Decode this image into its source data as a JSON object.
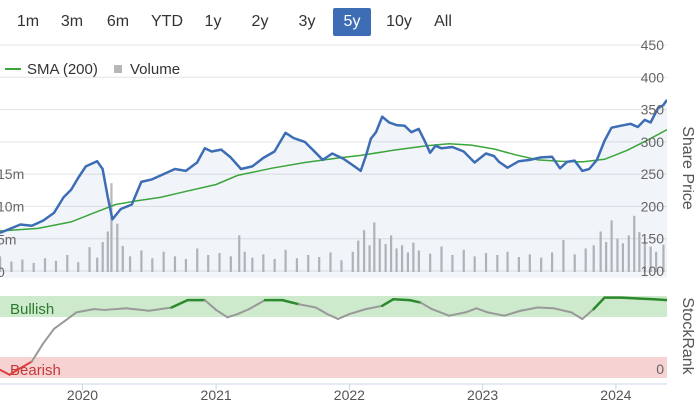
{
  "range_buttons": [
    {
      "label": "1m",
      "active": false
    },
    {
      "label": "3m",
      "active": false
    },
    {
      "label": "6m",
      "active": false
    },
    {
      "label": "YTD",
      "active": false
    },
    {
      "label": "1y",
      "active": false
    },
    {
      "label": "2y",
      "active": false
    },
    {
      "label": "3y",
      "active": false
    },
    {
      "label": "5y",
      "active": true
    },
    {
      "label": "10y",
      "active": false
    },
    {
      "label": "All",
      "active": false
    }
  ],
  "chart_data": {
    "type": "line",
    "colors": {
      "price": "#3d6db5",
      "sma": "#3aa53a",
      "volume": "#b8b8b8",
      "bullish_band": "#cdeacd",
      "bearish_band": "#f6d2d2",
      "rank_bullish": "#2c8a2c",
      "rank_neutral": "#999999",
      "rank_bearish": "#d94040",
      "active_button": "#3d6db5"
    },
    "legend": [
      {
        "label": "SMA (200)",
        "kind": "line"
      },
      {
        "label": "Volume",
        "kind": "square"
      }
    ],
    "x_axis": {
      "range": [
        "2019-05-20",
        "2024-05-20"
      ],
      "ticks": [
        {
          "label": "2020",
          "date": "2020-01-01"
        },
        {
          "label": "2021",
          "date": "2021-01-01"
        },
        {
          "label": "2022",
          "date": "2022-01-01"
        },
        {
          "label": "2023",
          "date": "2023-01-01"
        },
        {
          "label": "2024",
          "date": "2024-01-01"
        }
      ]
    },
    "price_axis": {
      "label": "Share Price",
      "range": [
        100,
        450
      ],
      "ticks": [
        "100",
        "150",
        "200",
        "250",
        "300",
        "350",
        "400",
        "450"
      ],
      "tick_values": [
        100,
        150,
        200,
        250,
        300,
        350,
        400,
        450
      ]
    },
    "volume_axis": {
      "ticks": [
        "0",
        "5m",
        "10m",
        "15m"
      ],
      "tick_values": [
        0,
        5,
        10,
        15
      ],
      "unit": "m"
    },
    "rank_panel": {
      "label": "StockRank",
      "zones": {
        "bullish": "Bullish",
        "bearish": "Bearish"
      },
      "range": [
        0,
        100
      ],
      "tick": "0",
      "tick_value": 0
    },
    "price_series": [
      [
        "2019-05-20",
        159
      ],
      [
        "2019-06-15",
        165
      ],
      [
        "2019-07-15",
        172
      ],
      [
        "2019-08-15",
        170
      ],
      [
        "2019-09-15",
        178
      ],
      [
        "2019-10-15",
        190
      ],
      [
        "2019-11-10",
        214
      ],
      [
        "2019-12-01",
        226
      ],
      [
        "2019-12-20",
        244
      ],
      [
        "2020-01-10",
        262
      ],
      [
        "2020-02-10",
        270
      ],
      [
        "2020-02-25",
        258
      ],
      [
        "2020-03-10",
        215
      ],
      [
        "2020-03-23",
        180
      ],
      [
        "2020-04-15",
        196
      ],
      [
        "2020-05-15",
        203
      ],
      [
        "2020-06-10",
        238
      ],
      [
        "2020-07-10",
        242
      ],
      [
        "2020-08-10",
        250
      ],
      [
        "2020-09-10",
        258
      ],
      [
        "2020-10-10",
        255
      ],
      [
        "2020-11-10",
        268
      ],
      [
        "2020-12-01",
        290
      ],
      [
        "2020-12-20",
        285
      ],
      [
        "2021-01-15",
        288
      ],
      [
        "2021-02-10",
        276
      ],
      [
        "2021-03-10",
        258
      ],
      [
        "2021-04-10",
        262
      ],
      [
        "2021-05-10",
        275
      ],
      [
        "2021-06-10",
        285
      ],
      [
        "2021-07-10",
        314
      ],
      [
        "2021-08-01",
        306
      ],
      [
        "2021-09-01",
        300
      ],
      [
        "2021-10-01",
        283
      ],
      [
        "2021-10-20",
        272
      ],
      [
        "2021-11-15",
        282
      ],
      [
        "2021-12-15",
        274
      ],
      [
        "2022-01-15",
        262
      ],
      [
        "2022-02-01",
        255
      ],
      [
        "2022-02-15",
        278
      ],
      [
        "2022-03-01",
        305
      ],
      [
        "2022-03-15",
        315
      ],
      [
        "2022-04-01",
        339
      ],
      [
        "2022-04-20",
        330
      ],
      [
        "2022-05-10",
        326
      ],
      [
        "2022-06-01",
        325
      ],
      [
        "2022-06-20",
        315
      ],
      [
        "2022-07-10",
        320
      ],
      [
        "2022-07-25",
        303
      ],
      [
        "2022-08-10",
        283
      ],
      [
        "2022-08-25",
        294
      ],
      [
        "2022-09-10",
        290
      ],
      [
        "2022-10-10",
        292
      ],
      [
        "2022-11-10",
        285
      ],
      [
        "2022-12-10",
        268
      ],
      [
        "2023-01-10",
        282
      ],
      [
        "2023-02-01",
        278
      ],
      [
        "2023-02-15",
        269
      ],
      [
        "2023-03-10",
        260
      ],
      [
        "2023-04-10",
        270
      ],
      [
        "2023-05-10",
        272
      ],
      [
        "2023-06-10",
        276
      ],
      [
        "2023-07-10",
        277
      ],
      [
        "2023-08-01",
        259
      ],
      [
        "2023-08-20",
        269
      ],
      [
        "2023-09-10",
        271
      ],
      [
        "2023-10-01",
        255
      ],
      [
        "2023-10-20",
        258
      ],
      [
        "2023-11-10",
        272
      ],
      [
        "2023-12-01",
        302
      ],
      [
        "2023-12-20",
        322
      ],
      [
        "2024-01-15",
        325
      ],
      [
        "2024-02-10",
        328
      ],
      [
        "2024-03-01",
        323
      ],
      [
        "2024-03-20",
        334
      ],
      [
        "2024-04-05",
        330
      ],
      [
        "2024-04-25",
        352
      ],
      [
        "2024-05-10",
        357
      ],
      [
        "2024-05-20",
        365
      ]
    ],
    "sma_series": [
      [
        "2019-05-20",
        162
      ],
      [
        "2019-09-01",
        166
      ],
      [
        "2019-12-01",
        176
      ],
      [
        "2020-02-01",
        190
      ],
      [
        "2020-04-01",
        203
      ],
      [
        "2020-06-01",
        209
      ],
      [
        "2020-08-01",
        214
      ],
      [
        "2020-10-01",
        222
      ],
      [
        "2021-01-01",
        234
      ],
      [
        "2021-03-01",
        248
      ],
      [
        "2021-06-01",
        259
      ],
      [
        "2021-09-01",
        268
      ],
      [
        "2021-12-01",
        275
      ],
      [
        "2022-02-01",
        279
      ],
      [
        "2022-05-01",
        287
      ],
      [
        "2022-08-01",
        294
      ],
      [
        "2022-10-01",
        297
      ],
      [
        "2022-12-01",
        295
      ],
      [
        "2023-02-01",
        289
      ],
      [
        "2023-04-01",
        280
      ],
      [
        "2023-06-01",
        272
      ],
      [
        "2023-08-01",
        270
      ],
      [
        "2023-10-01",
        269
      ],
      [
        "2023-12-01",
        273
      ],
      [
        "2024-02-01",
        287
      ],
      [
        "2024-04-01",
        304
      ],
      [
        "2024-05-20",
        319
      ]
    ],
    "stockrank_series": [
      [
        "2019-05-20",
        10
      ],
      [
        "2019-06-15",
        4
      ],
      [
        "2019-07-15",
        12
      ],
      [
        "2019-08-15",
        20
      ],
      [
        "2019-09-15",
        42
      ],
      [
        "2019-10-15",
        60
      ],
      [
        "2019-11-15",
        70
      ],
      [
        "2019-12-15",
        80
      ],
      [
        "2020-02-01",
        84
      ],
      [
        "2020-03-01",
        83
      ],
      [
        "2020-05-01",
        85
      ],
      [
        "2020-07-01",
        82
      ],
      [
        "2020-09-01",
        86
      ],
      [
        "2020-10-15",
        95
      ],
      [
        "2020-12-01",
        95
      ],
      [
        "2021-01-01",
        83
      ],
      [
        "2021-02-01",
        74
      ],
      [
        "2021-03-01",
        78
      ],
      [
        "2021-04-01",
        84
      ],
      [
        "2021-05-15",
        95
      ],
      [
        "2021-07-01",
        95
      ],
      [
        "2021-08-15",
        90
      ],
      [
        "2021-10-01",
        86
      ],
      [
        "2021-11-01",
        78
      ],
      [
        "2021-12-01",
        72
      ],
      [
        "2022-01-01",
        78
      ],
      [
        "2022-02-15",
        84
      ],
      [
        "2022-04-01",
        88
      ],
      [
        "2022-05-01",
        96
      ],
      [
        "2022-06-15",
        95
      ],
      [
        "2022-07-15",
        92
      ],
      [
        "2022-08-15",
        84
      ],
      [
        "2022-10-01",
        76
      ],
      [
        "2022-11-15",
        80
      ],
      [
        "2022-12-15",
        85
      ],
      [
        "2023-01-15",
        80
      ],
      [
        "2023-03-01",
        76
      ],
      [
        "2023-04-15",
        82
      ],
      [
        "2023-06-01",
        86
      ],
      [
        "2023-07-15",
        85
      ],
      [
        "2023-09-01",
        80
      ],
      [
        "2023-10-01",
        72
      ],
      [
        "2023-11-01",
        84
      ],
      [
        "2023-12-01",
        98
      ],
      [
        "2024-01-15",
        98
      ],
      [
        "2024-03-01",
        97
      ],
      [
        "2024-04-15",
        96
      ],
      [
        "2024-05-20",
        95
      ]
    ],
    "volume_series": [
      [
        "2019-05-20",
        2.4
      ],
      [
        "2019-06-20",
        1.6
      ],
      [
        "2019-07-20",
        1.9
      ],
      [
        "2019-08-20",
        1.4
      ],
      [
        "2019-09-20",
        2.1
      ],
      [
        "2019-10-20",
        1.7
      ],
      [
        "2019-11-20",
        2.6
      ],
      [
        "2019-12-20",
        1.5
      ],
      [
        "2020-01-20",
        3.8
      ],
      [
        "2020-02-10",
        2.2
      ],
      [
        "2020-02-25",
        4.6
      ],
      [
        "2020-03-10",
        6.2
      ],
      [
        "2020-03-20",
        13.6
      ],
      [
        "2020-04-05",
        7.4
      ],
      [
        "2020-04-20",
        4.0
      ],
      [
        "2020-05-10",
        2.4
      ],
      [
        "2020-06-10",
        3.3
      ],
      [
        "2020-07-10",
        2.1
      ],
      [
        "2020-08-10",
        3.1
      ],
      [
        "2020-09-10",
        2.4
      ],
      [
        "2020-10-10",
        2.0
      ],
      [
        "2020-11-10",
        3.6
      ],
      [
        "2020-12-10",
        2.6
      ],
      [
        "2021-01-10",
        2.9
      ],
      [
        "2021-02-10",
        2.4
      ],
      [
        "2021-03-05",
        5.6
      ],
      [
        "2021-03-20",
        3.1
      ],
      [
        "2021-04-10",
        2.2
      ],
      [
        "2021-05-10",
        2.7
      ],
      [
        "2021-06-10",
        2.0
      ],
      [
        "2021-07-10",
        3.4
      ],
      [
        "2021-08-10",
        2.1
      ],
      [
        "2021-09-10",
        2.6
      ],
      [
        "2021-10-10",
        2.3
      ],
      [
        "2021-11-10",
        3.0
      ],
      [
        "2021-12-10",
        1.8
      ],
      [
        "2022-01-10",
        3.1
      ],
      [
        "2022-01-25",
        4.8
      ],
      [
        "2022-02-10",
        6.4
      ],
      [
        "2022-02-25",
        4.1
      ],
      [
        "2022-03-10",
        7.6
      ],
      [
        "2022-03-25",
        5.1
      ],
      [
        "2022-04-10",
        4.3
      ],
      [
        "2022-04-25",
        5.6
      ],
      [
        "2022-05-10",
        3.6
      ],
      [
        "2022-05-25",
        4.1
      ],
      [
        "2022-06-10",
        3.0
      ],
      [
        "2022-06-25",
        4.5
      ],
      [
        "2022-07-10",
        3.3
      ],
      [
        "2022-08-10",
        2.8
      ],
      [
        "2022-09-10",
        3.9
      ],
      [
        "2022-10-10",
        2.6
      ],
      [
        "2022-11-10",
        3.4
      ],
      [
        "2022-12-10",
        2.4
      ],
      [
        "2023-01-10",
        2.9
      ],
      [
        "2023-02-10",
        2.6
      ],
      [
        "2023-03-10",
        3.1
      ],
      [
        "2023-04-10",
        2.3
      ],
      [
        "2023-05-10",
        2.7
      ],
      [
        "2023-06-10",
        2.2
      ],
      [
        "2023-07-10",
        3.0
      ],
      [
        "2023-08-10",
        4.9
      ],
      [
        "2023-09-10",
        2.7
      ],
      [
        "2023-10-10",
        3.6
      ],
      [
        "2023-11-01",
        4.1
      ],
      [
        "2023-11-20",
        6.2
      ],
      [
        "2023-12-05",
        4.6
      ],
      [
        "2023-12-20",
        7.9
      ],
      [
        "2024-01-05",
        5.1
      ],
      [
        "2024-01-20",
        4.4
      ],
      [
        "2024-02-05",
        5.6
      ],
      [
        "2024-02-20",
        8.6
      ],
      [
        "2024-03-05",
        6.1
      ],
      [
        "2024-03-20",
        4.6
      ],
      [
        "2024-04-05",
        3.9
      ],
      [
        "2024-04-20",
        3.1
      ],
      [
        "2024-05-10",
        4.2
      ]
    ]
  }
}
